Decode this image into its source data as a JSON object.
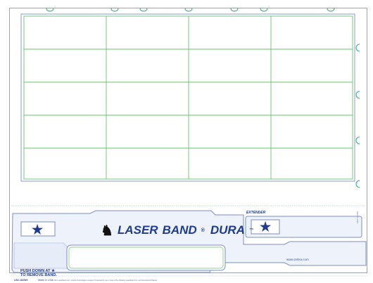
{
  "brand": {
    "name_laser": "LASER",
    "name_band": "BAND",
    "registered": "®",
    "name_dura": "DURA",
    "trademark": "™"
  },
  "labels": {
    "extender": "EXTENDER",
    "push_line1": "PUSH DOWN AT ★",
    "push_line2": "TO REMOVE BAND.",
    "website": "www.zebra.com",
    "sku": "LB2-182W9",
    "made_in": "Made in USA",
    "legal": "© 2013 LaserBand LLC, a Zebra Technologies company. Protected by one or more of the following LaserBand U.S. and International Patents.",
    "side_code": "0402 182W9"
  },
  "icons": {
    "star": "★",
    "brand_mark": "zebra-head-icon"
  },
  "colors": {
    "grid": "#69c46f",
    "band_outline": "#7a8fc6",
    "band_fill": "#eef2fa",
    "brand_blue": "#1f3b8f",
    "tab": "#2fa86a"
  },
  "label_grid": {
    "rows": 5,
    "cols": 4
  }
}
